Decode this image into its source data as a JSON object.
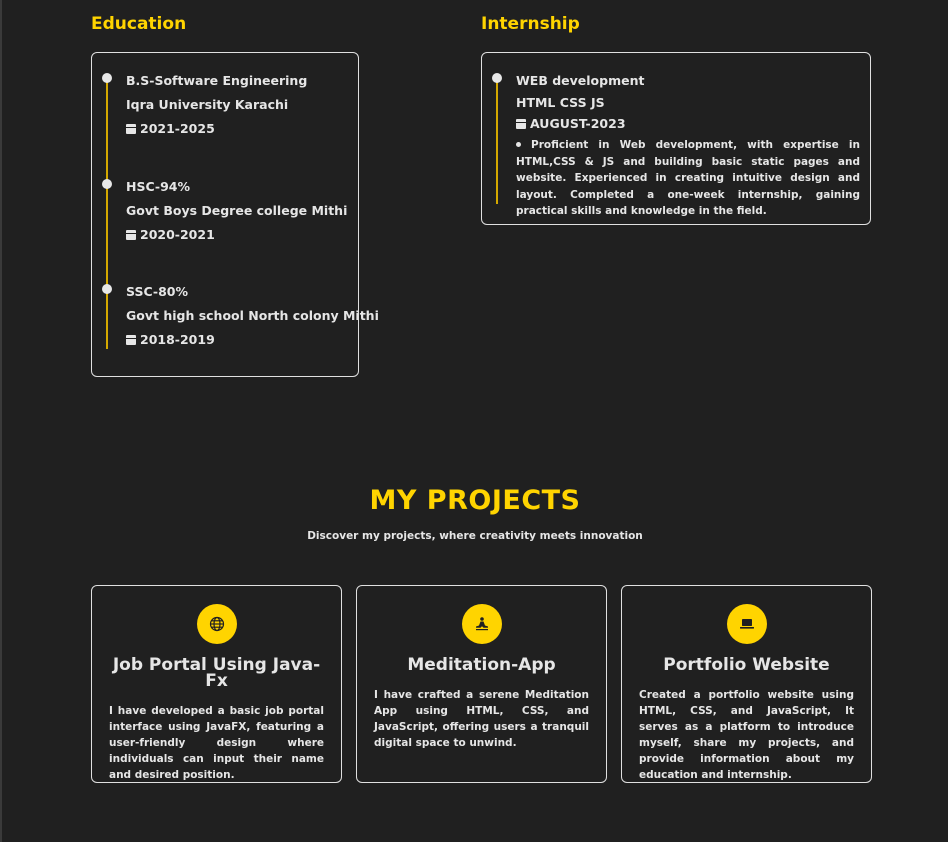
{
  "education": {
    "title": "Education",
    "items": [
      {
        "degree": "B.S-Software Engineering",
        "institution": "Iqra University Karachi",
        "years": "2021-2025"
      },
      {
        "degree": "HSC-94%",
        "institution": "Govt Boys Degree college Mithi",
        "years": "2020-2021"
      },
      {
        "degree": "SSC-80%",
        "institution": "Govt high school North colony Mithi",
        "years": "2018-2019"
      }
    ]
  },
  "internship": {
    "title": "Internship",
    "role": "WEB development",
    "skills": "HTML CSS JS",
    "date": "AUGUST-2023",
    "description": "Proficient in Web development, with expertise in HTML,CSS & JS and building basic static pages and website. Experienced in creating intuitive design and layout. Completed a one-week internship, gaining practical skills and knowledge in the field."
  },
  "projects": {
    "heading": "MY PROJECTS",
    "subheading": "Discover my projects, where creativity meets innovation",
    "items": [
      {
        "icon": "globe-icon",
        "title": "Job Portal Using Java-Fx",
        "description": "I have developed a basic job portal interface using JavaFX, featuring a user-friendly design where individuals can input their name and desired position."
      },
      {
        "icon": "meditation-icon",
        "title": "Meditation-App",
        "description": "I have crafted a serene Meditation App using HTML, CSS, and JavaScript, offering users a tranquil digital space to unwind."
      },
      {
        "icon": "laptop-icon",
        "title": "Portfolio Website",
        "description": "Created a portfolio website using HTML, CSS, and JavaScript, It serves as a platform to introduce myself, share my projects, and provide information about my education and internship."
      }
    ]
  },
  "colors": {
    "accent": "#ffd400",
    "background": "#202020",
    "text": "#e6e6e6"
  }
}
